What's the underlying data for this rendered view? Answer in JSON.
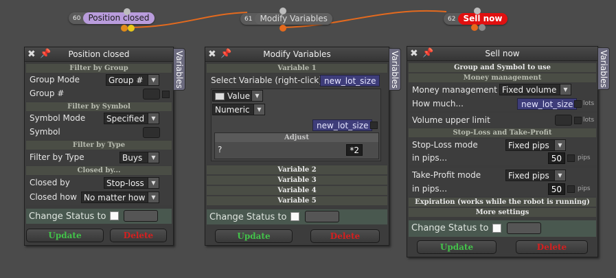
{
  "nodes": [
    {
      "num": "60",
      "label": "Position closed",
      "label_bg": "#b99cdc",
      "label_color": "#1a1a1a"
    },
    {
      "num": "61",
      "label": "Modify Variables",
      "label_bg": "#606060",
      "label_color": "#dddddd"
    },
    {
      "num": "62",
      "label": "Sell now",
      "label_bg": "#e01010",
      "label_color": "#ffffff"
    }
  ],
  "connector_color": "#e46a1e",
  "panel1": {
    "title": "Position closed",
    "vtab": "Variables",
    "sec_group": "Filter by Group",
    "group_mode_label": "Group Mode",
    "group_mode_value": "Group #",
    "group_num_label": "Group #",
    "sec_symbol": "Filter by Symbol",
    "symbol_mode_label": "Symbol Mode",
    "symbol_mode_value": "Specified",
    "symbol_label": "Symbol",
    "sec_type": "Filter by Type",
    "filter_type_label": "Filter by Type",
    "filter_type_value": "Buys",
    "sec_closed": "Closed by...",
    "closed_by_label": "Closed by",
    "closed_by_value": "Stop-loss",
    "closed_how_label": "Closed how",
    "closed_how_value": "No matter how",
    "status_label": "Change Status to",
    "update": "Update",
    "delete": "Delete"
  },
  "panel2": {
    "title": "Modify Variables",
    "vtab": "Variables",
    "sec_var1": "Variable 1",
    "select_var_label": "Select Variable (right-click)",
    "select_var_value": "new_lot_size",
    "value_type": "Value",
    "num_type": "Numeric",
    "var_value": "new_lot_size",
    "adjust_label": "Adjust",
    "adjust_op": "?",
    "adjust_value": "*2",
    "var2": "Variable 2",
    "var3": "Variable 3",
    "var4": "Variable 4",
    "var5": "Variable 5",
    "status_label": "Change Status to",
    "update": "Update",
    "delete": "Delete"
  },
  "panel3": {
    "title": "Sell now",
    "vtab": "Variables",
    "sec_group_symbol": "Group and Symbol to use",
    "sec_money": "Money management",
    "mm_label": "Money management",
    "mm_value": "Fixed volume",
    "how_much_label": "How much...",
    "how_much_value": "new_lot_size",
    "lots1": "lots",
    "vol_limit_label": "Volume upper limit",
    "lots2": "lots",
    "sec_sltp": "Stop-Loss and Take-Profit",
    "sl_mode_label": "Stop-Loss mode",
    "sl_mode_value": "Fixed pips",
    "sl_pips_label": "in pips...",
    "sl_pips_value": "50",
    "pips1": "pips",
    "tp_mode_label": "Take-Profit mode",
    "tp_mode_value": "Fixed pips",
    "tp_pips_label": "in pips...",
    "tp_pips_value": "50",
    "pips2": "pips",
    "sec_expiration": "Expiration (works while the robot is running)",
    "sec_more": "More settings",
    "status_label": "Change Status to",
    "update": "Update",
    "delete": "Delete"
  }
}
